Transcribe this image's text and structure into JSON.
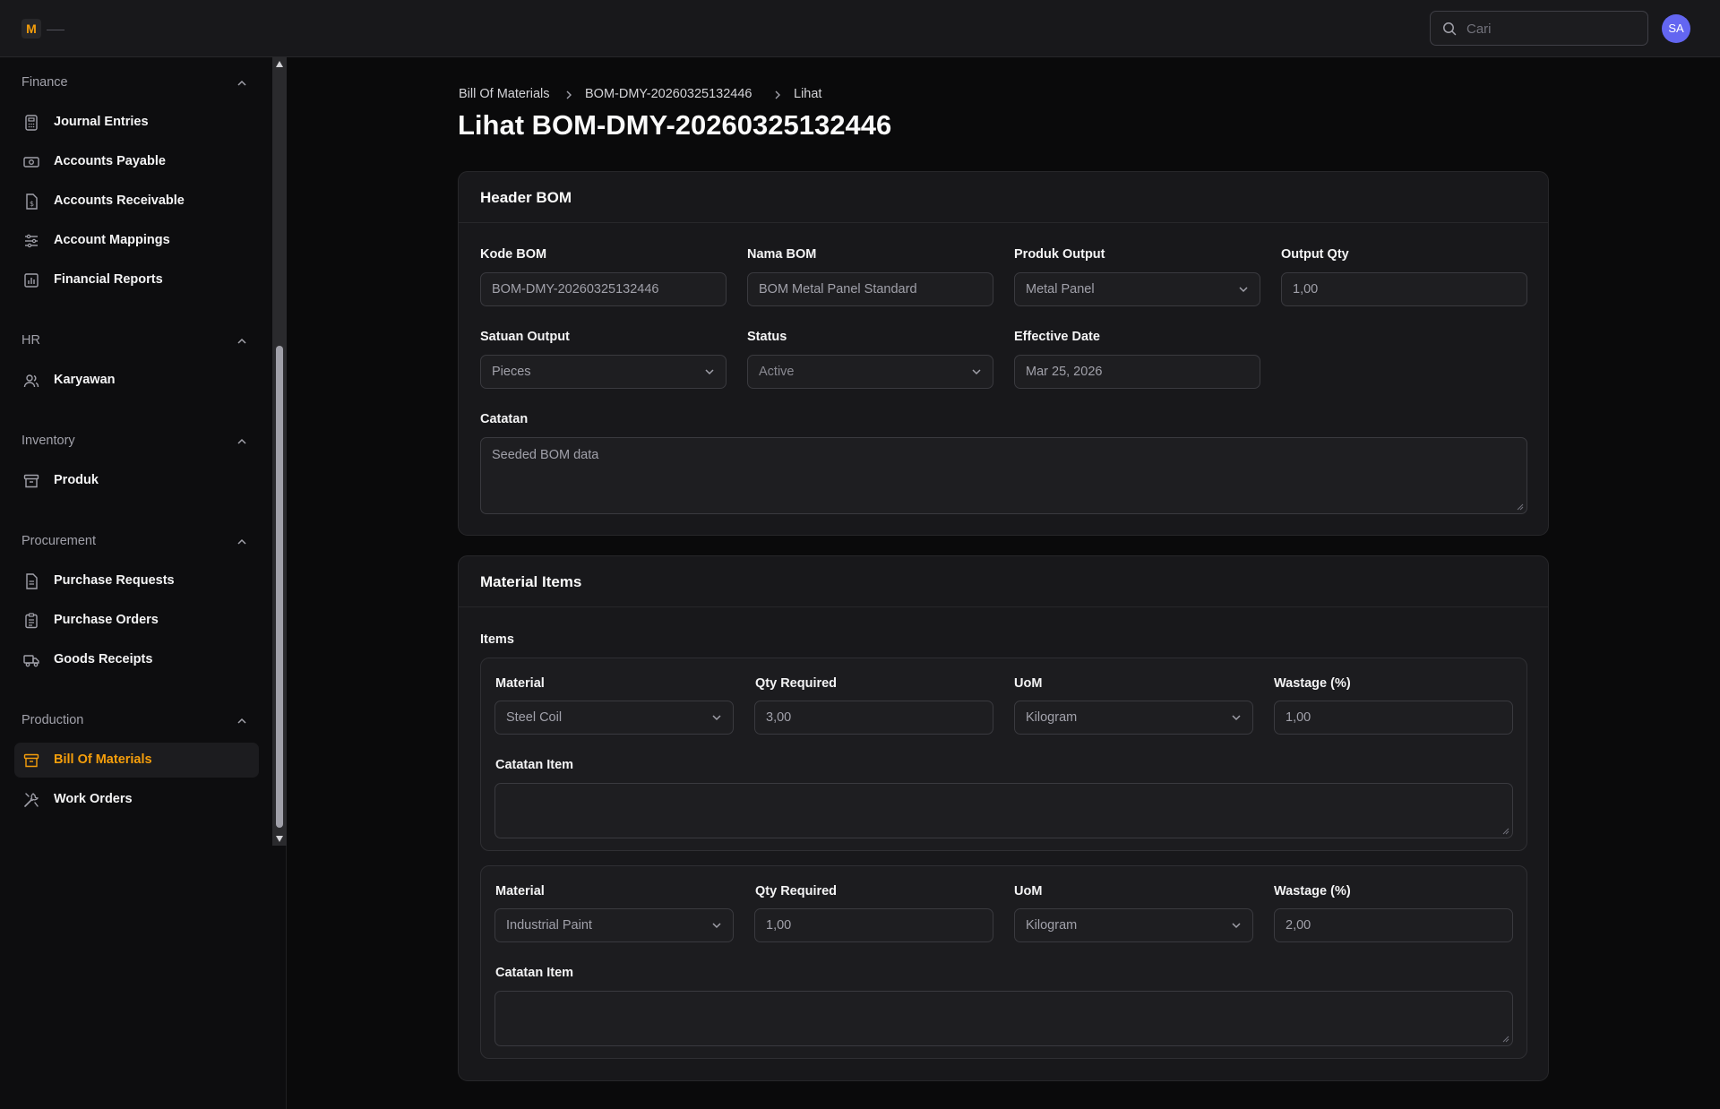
{
  "topbar": {
    "logo_letter": "M",
    "search_placeholder": "Cari",
    "avatar_initials": "SA"
  },
  "sidebar": {
    "groups": [
      {
        "title": "Finance",
        "items": [
          "Journal Entries",
          "Accounts Payable",
          "Accounts Receivable",
          "Account Mappings",
          "Financial Reports"
        ]
      },
      {
        "title": "HR",
        "items": [
          "Karyawan"
        ]
      },
      {
        "title": "Inventory",
        "items": [
          "Produk"
        ]
      },
      {
        "title": "Procurement",
        "items": [
          "Purchase Requests",
          "Purchase Orders",
          "Goods Receipts"
        ]
      },
      {
        "title": "Production",
        "items": [
          "Bill Of Materials",
          "Work Orders"
        ]
      }
    ],
    "active_item": "Bill Of Materials",
    "accent_color": "#f59e0b"
  },
  "breadcrumb": [
    "Bill Of Materials",
    "BOM-DMY-20260325132446",
    "Lihat"
  ],
  "page_title": "Lihat BOM-DMY-20260325132446",
  "header_card": {
    "title": "Header BOM",
    "fields": {
      "kode_bom": {
        "label": "Kode BOM",
        "value": "BOM-DMY-20260325132446"
      },
      "nama_bom": {
        "label": "Nama BOM",
        "value": "BOM Metal Panel Standard"
      },
      "produk_output": {
        "label": "Produk Output",
        "value": "Metal Panel"
      },
      "output_qty": {
        "label": "Output Qty",
        "value": "1,00"
      },
      "satuan_output": {
        "label": "Satuan Output",
        "value": "Pieces"
      },
      "status": {
        "label": "Status",
        "value": "Active"
      },
      "effective_date": {
        "label": "Effective Date",
        "value": "Mar 25, 2026"
      },
      "catatan": {
        "label": "Catatan",
        "value": "Seeded BOM data"
      }
    }
  },
  "material_card": {
    "title": "Material Items",
    "items_label": "Items",
    "labels": {
      "material": "Material",
      "qty": "Qty Required",
      "uom": "UoM",
      "wastage": "Wastage (%)",
      "catatan": "Catatan Item"
    },
    "items": [
      {
        "material": "Steel Coil",
        "qty": "3,00",
        "uom": "Kilogram",
        "wastage": "1,00",
        "catatan": ""
      },
      {
        "material": "Industrial Paint",
        "qty": "1,00",
        "uom": "Kilogram",
        "wastage": "2,00",
        "catatan": ""
      }
    ]
  }
}
